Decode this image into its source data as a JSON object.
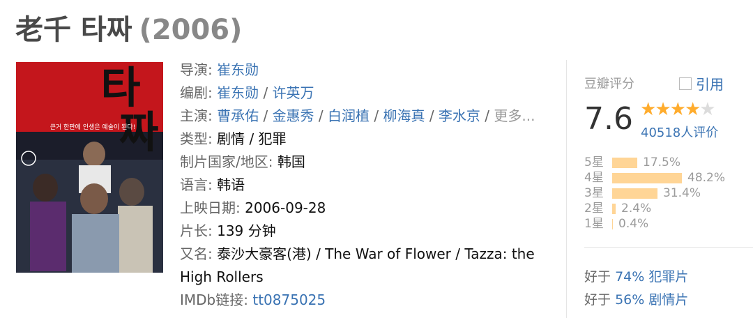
{
  "movie": {
    "title": "老千 타짜",
    "year": "(2006)",
    "poster_alt": "타짜 poster",
    "poster_title_line1": "타",
    "poster_title_line2": "짜",
    "poster_tagline": "큰거 한판에 인생은 예술이 된다!"
  },
  "info": {
    "director_label": "导演:",
    "director": "崔东勋",
    "writer_label": "编剧:",
    "writers": [
      "崔东勋",
      "许英万"
    ],
    "cast_label": "主演:",
    "cast": [
      "曹承佑",
      "金惠秀",
      "白润植",
      "柳海真",
      "李水京"
    ],
    "cast_more": "更多...",
    "genre_label": "类型:",
    "genres": "剧情 / 犯罪",
    "country_label": "制片国家/地区:",
    "country": "韩国",
    "language_label": "语言:",
    "language": "韩语",
    "release_label": "上映日期:",
    "release": "2006-09-28",
    "runtime_label": "片长:",
    "runtime": "139 分钟",
    "aka_label": "又名:",
    "aka": "泰沙大豪客(港) / The War of Flower / Tazza: the High Rollers",
    "imdb_label": "IMDb链接:",
    "imdb": "tt0875025",
    "separator": " / "
  },
  "rating": {
    "label": "豆瓣评分",
    "quote_label": "引用",
    "score": "7.6",
    "stars_on": 4,
    "stars_total": 5,
    "votes": "40518人评价",
    "distribution": [
      {
        "label": "5星",
        "percent": "17.5%",
        "value": 17.5
      },
      {
        "label": "4星",
        "percent": "48.2%",
        "value": 48.2
      },
      {
        "label": "3星",
        "percent": "31.4%",
        "value": 31.4
      },
      {
        "label": "2星",
        "percent": "2.4%",
        "value": 2.4
      },
      {
        "label": "1星",
        "percent": "0.4%",
        "value": 0.4
      }
    ],
    "better_than": [
      {
        "prefix": "好于",
        "text": "74% 犯罪片"
      },
      {
        "prefix": "好于",
        "text": "56% 剧情片"
      }
    ]
  },
  "colors": {
    "link": "#3a73b3",
    "star_on": "#ffac2d",
    "bar": "#ffd596",
    "poster_red": "#c4161c"
  }
}
